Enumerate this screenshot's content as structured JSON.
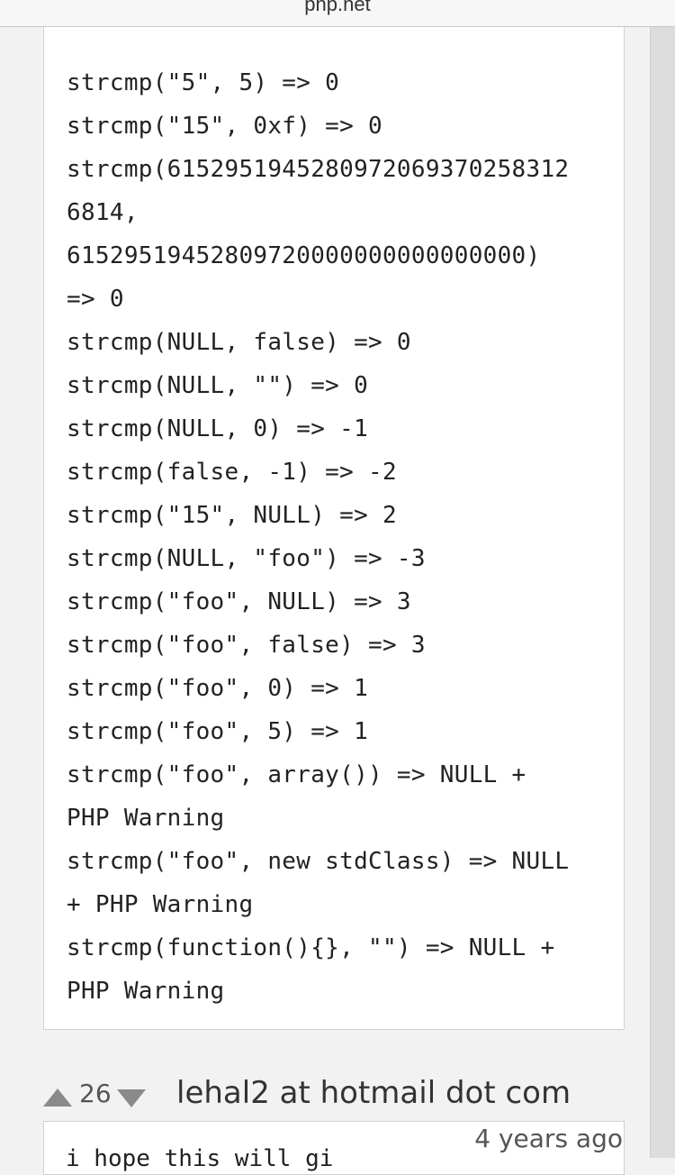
{
  "browser": {
    "domain": "php.net"
  },
  "code": {
    "lines": [
      "strcmp(\"5\", 5) => 0",
      "strcmp(\"15\", 0xf) => 0",
      "strcmp(615295194528097206937025831​2",
      "6814,",
      "61529519452809720000000000000000)",
      "=> 0",
      "strcmp(NULL, false) => 0",
      "strcmp(NULL, \"\") => 0",
      "strcmp(NULL, 0) => -1",
      "strcmp(false, -1) => -2",
      "strcmp(\"15\", NULL) => 2",
      "strcmp(NULL, \"foo\") => -3",
      "strcmp(\"foo\", NULL) => 3",
      "strcmp(\"foo\", false) => 3",
      "strcmp(\"foo\", 0) => 1",
      "strcmp(\"foo\", 5) => 1",
      "strcmp(\"foo\", array()) => NULL +",
      "PHP Warning",
      "strcmp(\"foo\", new stdClass) => NULL",
      "+ PHP Warning",
      "strcmp(function(){}, \"\") => NULL +",
      "PHP Warning"
    ]
  },
  "note": {
    "votes": "26",
    "author": "lehal2 at hotmail dot com",
    "age": "4 years ago",
    "snippet": "i hope this will gi"
  },
  "icons": {
    "vote_up": "triangle-up-icon",
    "vote_down": "triangle-down-icon"
  }
}
